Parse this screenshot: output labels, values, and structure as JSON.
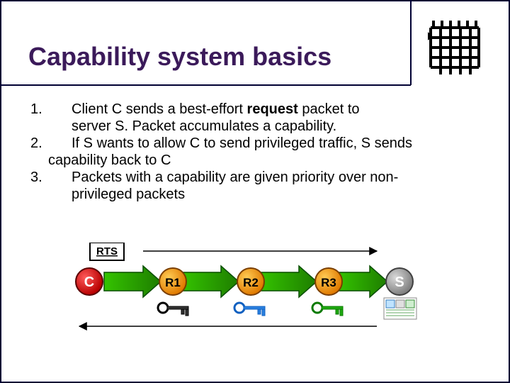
{
  "title": "Capability system basics",
  "points": {
    "n1": "1.",
    "p1a": "Client C sends a best-effort ",
    "p1req": "request",
    "p1b": " packet to",
    "p1c": "server S. Packet accumulates a capability.",
    "n2": "2.",
    "p2a": "If S wants to allow C to send privileged traffic, S        sends",
    "p2b": "capability back to C",
    "n3": "3.",
    "p3a": "Packets with a capability are given priority over non-",
    "p3b": "privileged packets"
  },
  "diagram": {
    "nodes": {
      "c": "C",
      "r1": "R1",
      "r2": "R2",
      "r3": "R3",
      "s": "S",
      "rts": "RTS"
    }
  }
}
